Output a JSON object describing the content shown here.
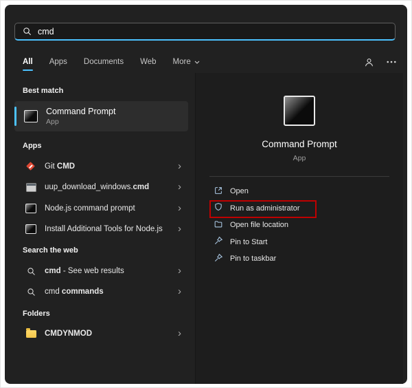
{
  "colors": {
    "accent": "#4cc2ff",
    "annotation": "#bf0000"
  },
  "search": {
    "value": "cmd"
  },
  "tabs": {
    "items": [
      {
        "label": "All"
      },
      {
        "label": "Apps"
      },
      {
        "label": "Documents"
      },
      {
        "label": "Web"
      },
      {
        "label": "More"
      }
    ]
  },
  "results": {
    "best_match": {
      "header": "Best match",
      "item": {
        "title": "Command Prompt",
        "subtitle": "App"
      }
    },
    "apps": {
      "header": "Apps",
      "items": [
        {
          "pre": "Git ",
          "bold": "CMD"
        },
        {
          "pre": "uup_download_windows.",
          "bold": "cmd"
        },
        {
          "pre": "Node.js command prompt",
          "bold": ""
        },
        {
          "pre": "Install Additional Tools for Node.js",
          "bold": ""
        }
      ]
    },
    "web": {
      "header": "Search the web",
      "items": [
        {
          "part1": "cmd",
          "part2": " - See web results"
        },
        {
          "part1": "cmd",
          "part2": " commands"
        }
      ]
    },
    "folders": {
      "header": "Folders",
      "items": [
        {
          "label": "CMDYNMOD"
        }
      ]
    }
  },
  "preview": {
    "title": "Command Prompt",
    "subtitle": "App",
    "actions": [
      {
        "label": "Open"
      },
      {
        "label": "Run as administrator"
      },
      {
        "label": "Open file location"
      },
      {
        "label": "Pin to Start"
      },
      {
        "label": "Pin to taskbar"
      }
    ]
  }
}
